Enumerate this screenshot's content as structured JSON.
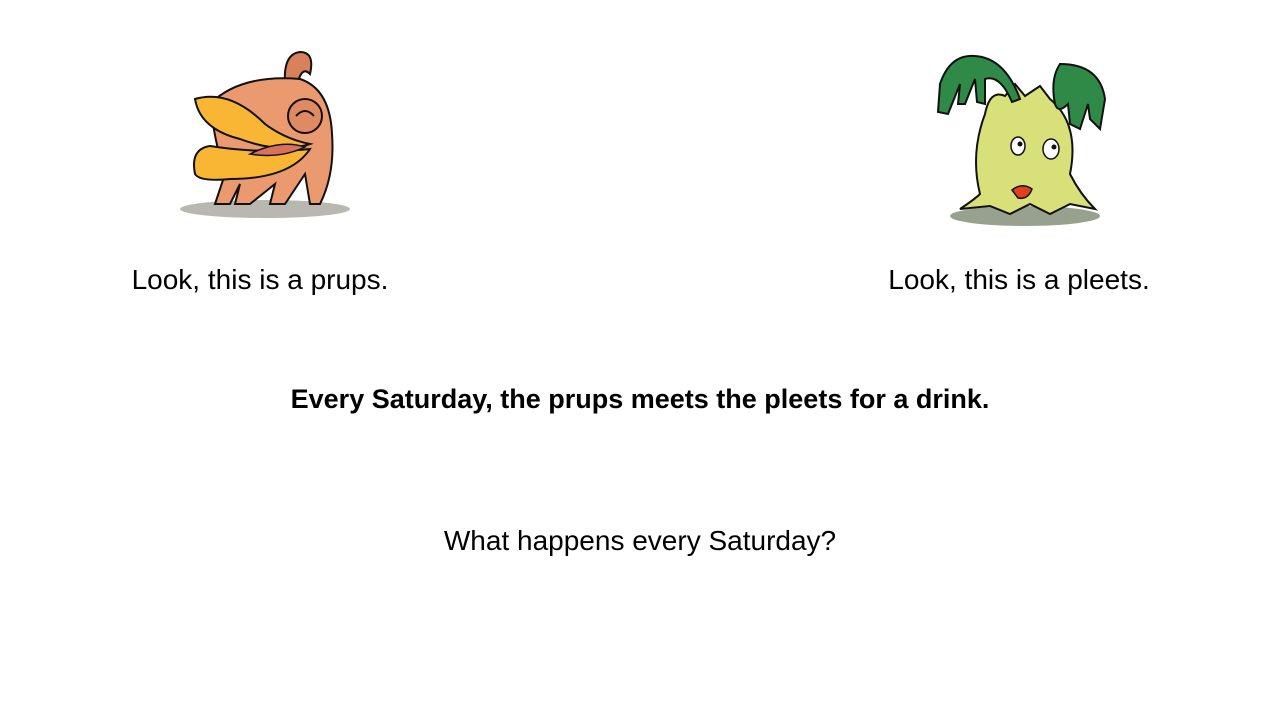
{
  "slide": {
    "left_creature": {
      "name": "prups",
      "caption": "Look, this is a prups.",
      "colors": {
        "body": "#e8946a",
        "beak": "#f7b733",
        "mouth": "#d9725a"
      }
    },
    "right_creature": {
      "name": "pleets",
      "caption": "Look, this is a pleets.",
      "colors": {
        "body": "#d6e27a",
        "hands": "#2f8a48",
        "mouth": "#e0401c"
      }
    },
    "statement": "Every Saturday, the prups meets the pleets for a drink.",
    "question": "What happens every Saturday?"
  }
}
